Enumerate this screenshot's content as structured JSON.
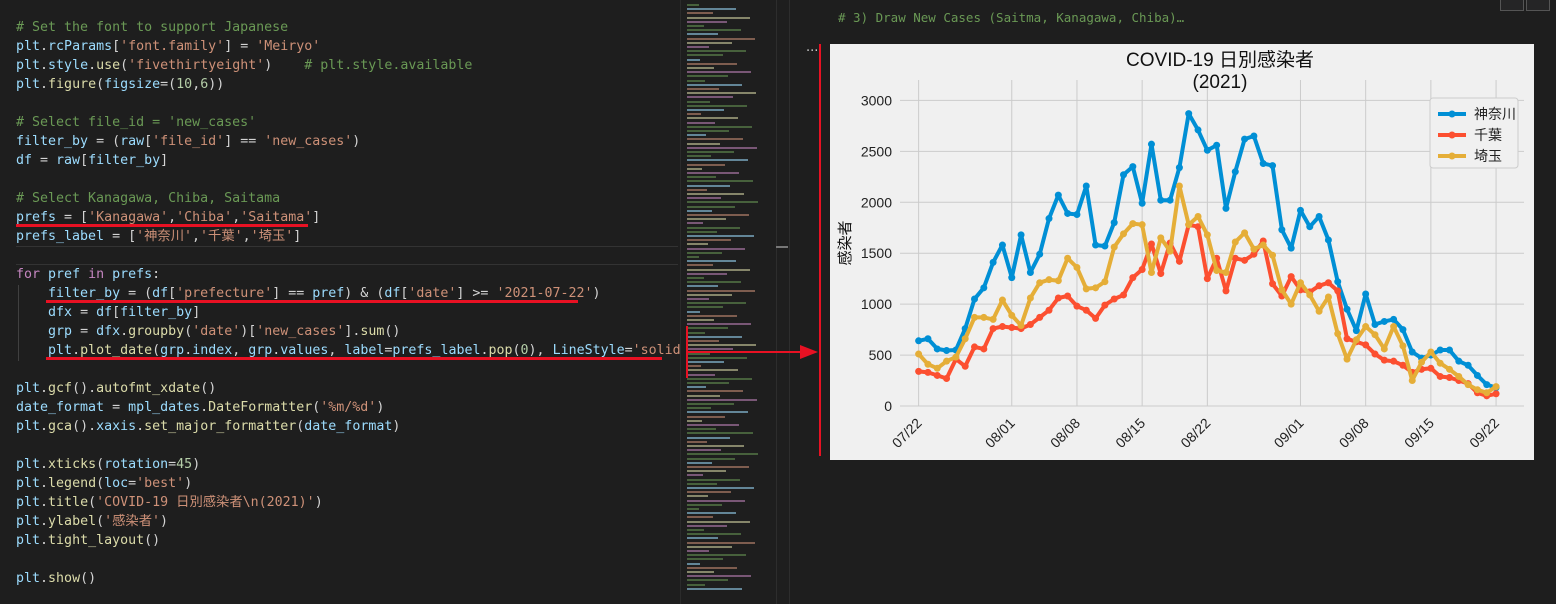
{
  "editor": {
    "lines": [
      [
        [
          "c-comment",
          "# Set the font to support Japanese"
        ]
      ],
      [
        [
          "c-var",
          "plt"
        ],
        [
          "c-plain",
          "."
        ],
        [
          "c-var",
          "rcParams"
        ],
        [
          "c-plain",
          "["
        ],
        [
          "c-str",
          "'font.family'"
        ],
        [
          "c-plain",
          "] = "
        ],
        [
          "c-str",
          "'Meiryo'"
        ]
      ],
      [
        [
          "c-var",
          "plt"
        ],
        [
          "c-plain",
          "."
        ],
        [
          "c-var",
          "style"
        ],
        [
          "c-plain",
          "."
        ],
        [
          "c-fn",
          "use"
        ],
        [
          "c-plain",
          "("
        ],
        [
          "c-str",
          "'fivethirtyeight'"
        ],
        [
          "c-plain",
          ")    "
        ],
        [
          "c-comment",
          "# plt.style.available"
        ]
      ],
      [
        [
          "c-var",
          "plt"
        ],
        [
          "c-plain",
          "."
        ],
        [
          "c-fn",
          "figure"
        ],
        [
          "c-plain",
          "("
        ],
        [
          "c-var",
          "figsize"
        ],
        [
          "c-plain",
          "=("
        ],
        [
          "c-num",
          "10"
        ],
        [
          "c-plain",
          ","
        ],
        [
          "c-num",
          "6"
        ],
        [
          "c-plain",
          "))"
        ]
      ],
      [],
      [
        [
          "c-comment",
          "# Select file_id = 'new_cases'"
        ]
      ],
      [
        [
          "c-var",
          "filter_by"
        ],
        [
          "c-plain",
          " = ("
        ],
        [
          "c-var",
          "raw"
        ],
        [
          "c-plain",
          "["
        ],
        [
          "c-str",
          "'file_id'"
        ],
        [
          "c-plain",
          "] == "
        ],
        [
          "c-str",
          "'new_cases'"
        ],
        [
          "c-plain",
          ")"
        ]
      ],
      [
        [
          "c-var",
          "df"
        ],
        [
          "c-plain",
          " = "
        ],
        [
          "c-var",
          "raw"
        ],
        [
          "c-plain",
          "["
        ],
        [
          "c-var",
          "filter_by"
        ],
        [
          "c-plain",
          "]"
        ]
      ],
      [],
      [
        [
          "c-comment",
          "# Select Kanagawa, Chiba, Saitama"
        ]
      ],
      [
        [
          "c-var",
          "prefs"
        ],
        [
          "c-plain",
          " = ["
        ],
        [
          "c-str",
          "'Kanagawa'"
        ],
        [
          "c-plain",
          ","
        ],
        [
          "c-str",
          "'Chiba'"
        ],
        [
          "c-plain",
          ","
        ],
        [
          "c-str",
          "'Saitama'"
        ],
        [
          "c-plain",
          "]"
        ]
      ],
      [
        [
          "c-var",
          "prefs_label"
        ],
        [
          "c-plain",
          " = ["
        ],
        [
          "c-str",
          "'神奈川'"
        ],
        [
          "c-plain",
          ","
        ],
        [
          "c-str",
          "'千葉'"
        ],
        [
          "c-plain",
          ","
        ],
        [
          "c-str",
          "'埼玉'"
        ],
        [
          "c-plain",
          "]"
        ]
      ],
      [],
      [
        [
          "c-kw",
          "for"
        ],
        [
          "c-plain",
          " "
        ],
        [
          "c-var",
          "pref"
        ],
        [
          "c-plain",
          " "
        ],
        [
          "c-kw",
          "in"
        ],
        [
          "c-plain",
          " "
        ],
        [
          "c-var",
          "prefs"
        ],
        [
          "c-plain",
          ":"
        ]
      ],
      [
        [
          "c-plain",
          "    "
        ],
        [
          "c-var",
          "filter_by"
        ],
        [
          "c-plain",
          " = ("
        ],
        [
          "c-var",
          "df"
        ],
        [
          "c-plain",
          "["
        ],
        [
          "c-str",
          "'prefecture'"
        ],
        [
          "c-plain",
          "] == "
        ],
        [
          "c-var",
          "pref"
        ],
        [
          "c-plain",
          ") & ("
        ],
        [
          "c-var",
          "df"
        ],
        [
          "c-plain",
          "["
        ],
        [
          "c-str",
          "'date'"
        ],
        [
          "c-plain",
          "] >= "
        ],
        [
          "c-str",
          "'2021-07-22'"
        ],
        [
          "c-plain",
          ")"
        ]
      ],
      [
        [
          "c-plain",
          "    "
        ],
        [
          "c-var",
          "dfx"
        ],
        [
          "c-plain",
          " = "
        ],
        [
          "c-var",
          "df"
        ],
        [
          "c-plain",
          "["
        ],
        [
          "c-var",
          "filter_by"
        ],
        [
          "c-plain",
          "]"
        ]
      ],
      [
        [
          "c-plain",
          "    "
        ],
        [
          "c-var",
          "grp"
        ],
        [
          "c-plain",
          " = "
        ],
        [
          "c-var",
          "dfx"
        ],
        [
          "c-plain",
          "."
        ],
        [
          "c-fn",
          "groupby"
        ],
        [
          "c-plain",
          "("
        ],
        [
          "c-str",
          "'date'"
        ],
        [
          "c-plain",
          ")["
        ],
        [
          "c-str",
          "'new_cases'"
        ],
        [
          "c-plain",
          "]."
        ],
        [
          "c-fn",
          "sum"
        ],
        [
          "c-plain",
          "()"
        ]
      ],
      [
        [
          "c-plain",
          "    "
        ],
        [
          "c-var",
          "plt"
        ],
        [
          "c-plain",
          "."
        ],
        [
          "c-fn",
          "plot_date"
        ],
        [
          "c-plain",
          "("
        ],
        [
          "c-var",
          "grp"
        ],
        [
          "c-plain",
          "."
        ],
        [
          "c-var",
          "index"
        ],
        [
          "c-plain",
          ", "
        ],
        [
          "c-var",
          "grp"
        ],
        [
          "c-plain",
          "."
        ],
        [
          "c-var",
          "values"
        ],
        [
          "c-plain",
          ", "
        ],
        [
          "c-var",
          "label"
        ],
        [
          "c-plain",
          "="
        ],
        [
          "c-var",
          "prefs_label"
        ],
        [
          "c-plain",
          "."
        ],
        [
          "c-fn",
          "pop"
        ],
        [
          "c-plain",
          "("
        ],
        [
          "c-num",
          "0"
        ],
        [
          "c-plain",
          "), "
        ],
        [
          "c-var",
          "LineStyle"
        ],
        [
          "c-plain",
          "="
        ],
        [
          "c-str",
          "'solid'"
        ],
        [
          "c-plain",
          ")"
        ]
      ],
      [],
      [
        [
          "c-var",
          "plt"
        ],
        [
          "c-plain",
          "."
        ],
        [
          "c-fn",
          "gcf"
        ],
        [
          "c-plain",
          "()."
        ],
        [
          "c-fn",
          "autofmt_xdate"
        ],
        [
          "c-plain",
          "()"
        ]
      ],
      [
        [
          "c-var",
          "date_format"
        ],
        [
          "c-plain",
          " = "
        ],
        [
          "c-var",
          "mpl_dates"
        ],
        [
          "c-plain",
          "."
        ],
        [
          "c-fn",
          "DateFormatter"
        ],
        [
          "c-plain",
          "("
        ],
        [
          "c-str",
          "'%m/%d'"
        ],
        [
          "c-plain",
          ")"
        ]
      ],
      [
        [
          "c-var",
          "plt"
        ],
        [
          "c-plain",
          "."
        ],
        [
          "c-fn",
          "gca"
        ],
        [
          "c-plain",
          "()."
        ],
        [
          "c-var",
          "xaxis"
        ],
        [
          "c-plain",
          "."
        ],
        [
          "c-fn",
          "set_major_formatter"
        ],
        [
          "c-plain",
          "("
        ],
        [
          "c-var",
          "date_format"
        ],
        [
          "c-plain",
          ")"
        ]
      ],
      [],
      [
        [
          "c-var",
          "plt"
        ],
        [
          "c-plain",
          "."
        ],
        [
          "c-fn",
          "xticks"
        ],
        [
          "c-plain",
          "("
        ],
        [
          "c-var",
          "rotation"
        ],
        [
          "c-plain",
          "="
        ],
        [
          "c-num",
          "45"
        ],
        [
          "c-plain",
          ")"
        ]
      ],
      [
        [
          "c-var",
          "plt"
        ],
        [
          "c-plain",
          "."
        ],
        [
          "c-fn",
          "legend"
        ],
        [
          "c-plain",
          "("
        ],
        [
          "c-var",
          "loc"
        ],
        [
          "c-plain",
          "="
        ],
        [
          "c-str",
          "'best'"
        ],
        [
          "c-plain",
          ")"
        ]
      ],
      [
        [
          "c-var",
          "plt"
        ],
        [
          "c-plain",
          "."
        ],
        [
          "c-fn",
          "title"
        ],
        [
          "c-plain",
          "("
        ],
        [
          "c-str",
          "'COVID-19 日別感染者\\n(2021)'"
        ],
        [
          "c-plain",
          ")"
        ]
      ],
      [
        [
          "c-var",
          "plt"
        ],
        [
          "c-plain",
          "."
        ],
        [
          "c-fn",
          "ylabel"
        ],
        [
          "c-plain",
          "("
        ],
        [
          "c-str",
          "'感染者'"
        ],
        [
          "c-plain",
          ")"
        ]
      ],
      [
        [
          "c-var",
          "plt"
        ],
        [
          "c-plain",
          "."
        ],
        [
          "c-fn",
          "tight_layout"
        ],
        [
          "c-plain",
          "()"
        ]
      ],
      [],
      [
        [
          "c-var",
          "plt"
        ],
        [
          "c-plain",
          "."
        ],
        [
          "c-fn",
          "show"
        ],
        [
          "c-plain",
          "()"
        ]
      ]
    ]
  },
  "output": {
    "cell_header": "# 3) Draw New Cases (Saitma, Kanagawa, Chiba)…",
    "more_dots": "..."
  },
  "chart_data": {
    "type": "line",
    "title": "COVID-19 日別感染者\n(2021)",
    "title_lines": [
      "COVID-19 日別感染者",
      "(2021)"
    ],
    "xlabel": "",
    "ylabel": "感染者",
    "ylim": [
      0,
      3200
    ],
    "yticks": [
      0,
      500,
      1000,
      1500,
      2000,
      2500,
      3000
    ],
    "x_start": "2021-07-22",
    "xticks": [
      "07/22",
      "08/01",
      "08/08",
      "08/15",
      "08/22",
      "09/01",
      "09/08",
      "09/15",
      "09/22"
    ],
    "xtick_dates": [
      "2021-07-22",
      "2021-08-01",
      "2021-08-08",
      "2021-08-15",
      "2021-08-22",
      "2021-09-01",
      "2021-09-08",
      "2021-09-15",
      "2021-09-22"
    ],
    "xlim": [
      "2021-07-20",
      "2021-09-25"
    ],
    "grid": true,
    "legend": "top-right",
    "series": [
      {
        "name": "神奈川",
        "color": "#008fd5",
        "values": [
          640,
          660,
          560,
          545,
          550,
          760,
          1050,
          1160,
          1410,
          1580,
          1260,
          1680,
          1310,
          1490,
          1840,
          2070,
          1890,
          1880,
          2160,
          1580,
          1570,
          1800,
          2270,
          2350,
          1990,
          2570,
          2020,
          2020,
          2340,
          2870,
          2710,
          2510,
          2560,
          1940,
          2300,
          2620,
          2650,
          2380,
          2360,
          1730,
          1550,
          1920,
          1760,
          1860,
          1630,
          1220,
          950,
          740,
          1100,
          800,
          830,
          850,
          750,
          530,
          470,
          500,
          550,
          550,
          440,
          400,
          300,
          210,
          180
        ]
      },
      {
        "name": "千葉",
        "color": "#fc4f30",
        "values": [
          340,
          330,
          300,
          270,
          460,
          390,
          580,
          560,
          760,
          780,
          770,
          760,
          800,
          870,
          940,
          1060,
          1080,
          980,
          940,
          860,
          990,
          1050,
          1090,
          1260,
          1340,
          1590,
          1300,
          1600,
          1420,
          1780,
          1760,
          1250,
          1450,
          1130,
          1450,
          1430,
          1490,
          1620,
          1200,
          1080,
          1270,
          1140,
          1120,
          1180,
          1210,
          1130,
          660,
          630,
          600,
          510,
          450,
          440,
          400,
          330,
          360,
          370,
          290,
          280,
          250,
          220,
          130,
          100,
          120
        ]
      },
      {
        "name": "埼玉",
        "color": "#e5ae38",
        "values": [
          510,
          410,
          370,
          440,
          480,
          660,
          870,
          870,
          850,
          1040,
          890,
          790,
          1060,
          1210,
          1240,
          1230,
          1450,
          1360,
          1150,
          1160,
          1220,
          1560,
          1690,
          1790,
          1780,
          1310,
          1650,
          1520,
          2160,
          1780,
          1860,
          1680,
          1330,
          1310,
          1610,
          1700,
          1540,
          1580,
          1480,
          1140,
          1000,
          1210,
          1090,
          930,
          1070,
          710,
          460,
          650,
          780,
          700,
          560,
          780,
          590,
          250,
          430,
          530,
          420,
          360,
          290,
          210,
          160,
          130,
          190
        ]
      }
    ]
  }
}
